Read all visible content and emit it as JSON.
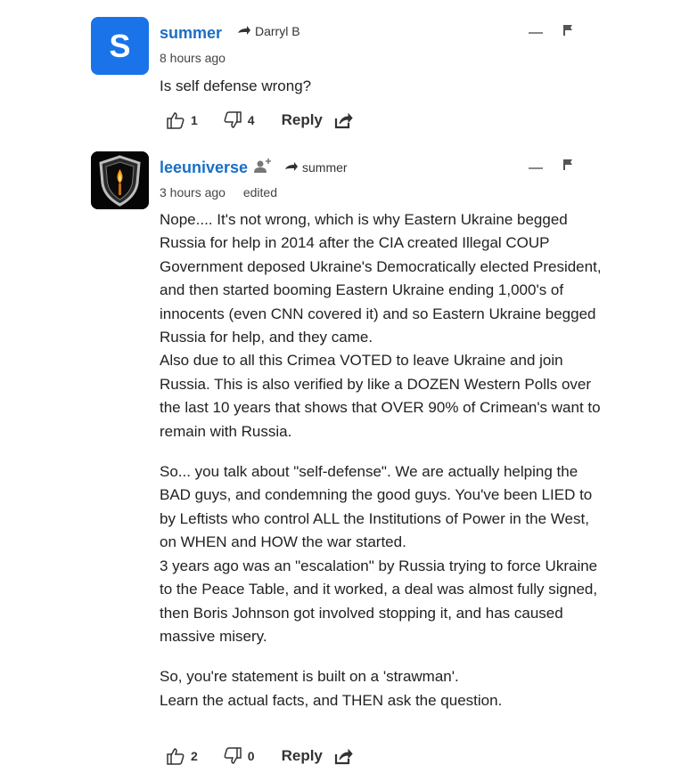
{
  "comments": [
    {
      "avatar_letter": "S",
      "username": "summer",
      "reply_to": "Darryl B",
      "time": "8 hours ago",
      "edited": "",
      "paragraphs": [
        "Is self defense wrong?"
      ],
      "likes": "1",
      "dislikes": "4",
      "reply_label": "Reply"
    },
    {
      "avatar_letter": "",
      "username": "leeuniverse",
      "reply_to": "summer",
      "time": "3 hours ago",
      "edited": "edited",
      "paragraphs": [
        "Nope.... It's not wrong, which is why Eastern Ukraine begged Russia for help in 2014 after the CIA created Illegal COUP Government deposed Ukraine's Democratically elected President, and then started booming Eastern Ukraine ending 1,000's of innocents (even CNN covered it) and so Eastern Ukraine begged Russia for help, and they came.\nAlso due to all this Crimea VOTED to leave Ukraine and join Russia. This is also verified by like a DOZEN Western Polls over the last 10 years that shows that OVER 90% of Crimean's want to remain with Russia.",
        "So... you talk about \"self-defense\". We are actually helping the BAD guys, and condemning the good guys. You've been LIED to by Leftists who control ALL the Institutions of Power in the West, on WHEN and HOW the war started.\n3 years ago was an \"escalation\" by Russia trying to force Ukraine to the Peace Table, and it worked, a deal was almost fully signed, then Boris Johnson got involved stopping it, and has caused massive misery.",
        "So, you're statement is built on a 'strawman'.\nLearn the actual facts, and THEN ask the question."
      ],
      "likes": "2",
      "dislikes": "0",
      "reply_label": "Reply"
    }
  ],
  "colors": {
    "accent": "#1a73e8",
    "username": "#1a6fc4",
    "text": "#222222",
    "muted": "#888888"
  },
  "icons": [
    "reply-arrow-icon",
    "follow-user-icon",
    "thumbs-up-icon",
    "thumbs-down-icon",
    "share-icon",
    "collapse-icon",
    "flag-icon",
    "shield-candle-icon"
  ]
}
